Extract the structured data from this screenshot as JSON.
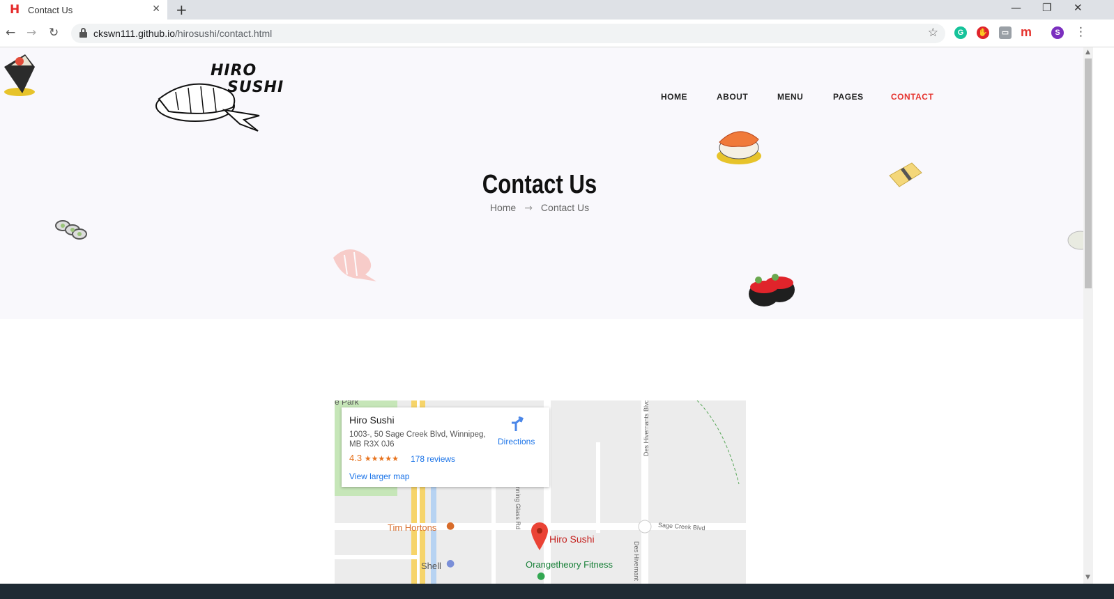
{
  "browser": {
    "tab_title": "Contact Us",
    "url_host": "ckswn111.github.io",
    "url_path": "/hirosushi/contact.html",
    "profile_initial": "S"
  },
  "site": {
    "logo_line1": "HIRO",
    "logo_line2": "SUSHI",
    "nav": [
      "HOME",
      "ABOUT",
      "MENU",
      "PAGES",
      "CONTACT"
    ],
    "active_nav": "CONTACT",
    "accent": "#e5322d"
  },
  "hero": {
    "title": "Contact Us",
    "breadcrumb_home": "Home",
    "breadcrumb_current": "Contact Us"
  },
  "map": {
    "place_name": "Hiro Sushi",
    "address": "1003-, 50 Sage Creek Blvd, Winnipeg, MB R3X 0J6",
    "rating": "4.3",
    "stars": "★★★★★",
    "reviews": "178 reviews",
    "view_larger": "View larger map",
    "directions": "Directions",
    "labels": {
      "park": "e Park",
      "tim_hortons": "Tim Hortons",
      "hiro_sushi": "Hiro Sushi",
      "shell": "Shell",
      "orangetheory": "Orangetheory Fitness",
      "sage_creek": "Sage Creek Blvd",
      "running_glass": "Running Glass Rd",
      "des_hivernants": "Des Hivernants Blvd",
      "des_hivernants_short": "Des Hivernant"
    }
  }
}
